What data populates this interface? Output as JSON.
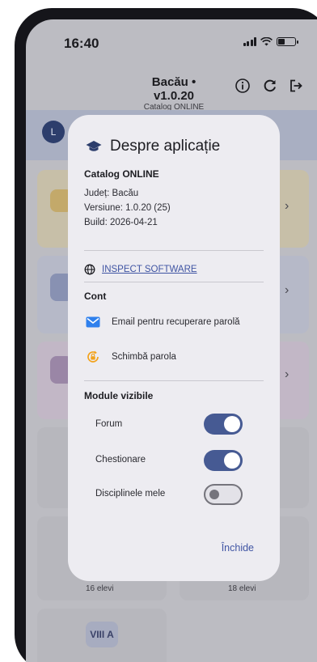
{
  "status_bar": {
    "time": "16:40"
  },
  "app_bar": {
    "title": "Bacău • v1.0.20",
    "subtitle": "Catalog ONLINE",
    "actions": [
      "info-icon",
      "refresh-icon",
      "logout-icon"
    ]
  },
  "background": {
    "avatar_initial": "L",
    "class_badge": "VIII A",
    "counts": [
      "16 elevi",
      "18 elevi"
    ]
  },
  "dialog": {
    "title": "Despre aplicație",
    "app_name": "Catalog ONLINE",
    "info": {
      "county": "Județ: Bacău",
      "version": "Versiune: 1.0.20 (25)",
      "build": "Build: 2026-04-21"
    },
    "vendor_link": "INSPECT SOFTWARE",
    "account": {
      "title": "Cont",
      "options": [
        "Email pentru recuperare parolă",
        "Schimbă parola"
      ]
    },
    "modules": {
      "title": "Module vizibile",
      "items": [
        {
          "label": "Forum",
          "enabled": true
        },
        {
          "label": "Chestionare",
          "enabled": true
        },
        {
          "label": "Disciplinele mele",
          "enabled": false
        }
      ]
    },
    "close_label": "Închide"
  },
  "colors": {
    "accent": "#465a93",
    "link": "#3f54a3",
    "email_icon": "#2f80ed",
    "lock_icon": "#f2a21b",
    "dialog_bg": "#edecf1"
  }
}
